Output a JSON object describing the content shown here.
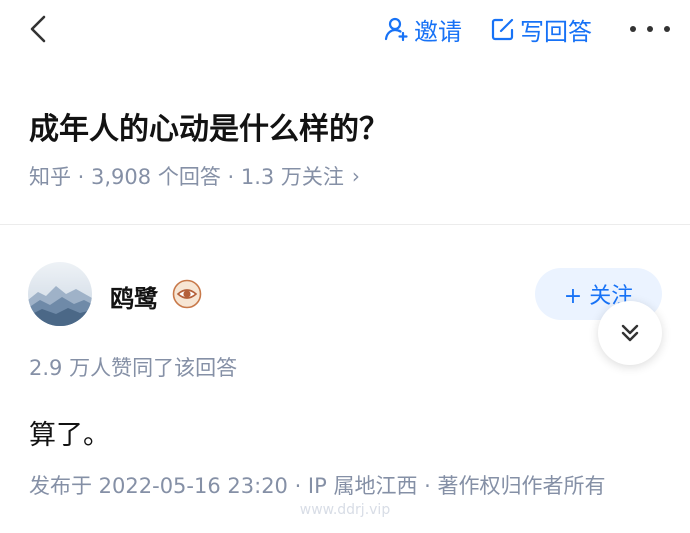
{
  "header": {
    "invite_label": "邀请",
    "write_label": "写回答",
    "icons": {
      "back": "chevron-left-icon",
      "invite": "add-person-icon",
      "write": "edit-icon",
      "more": "more-horizontal-icon"
    }
  },
  "question": {
    "title": "成年人的心动是什么样的？",
    "meta": "知乎 · 3,908 个回答 · 1.3 万关注",
    "meta_chevron": "›"
  },
  "answer": {
    "author_name": "鸥鹭",
    "follow_label": "+ 关注",
    "likes_text": "2.9 万人赞同了该回答",
    "content": "算了。",
    "publish_info": "发布于 2022-05-16 23:20 · IP 属地江西 · 著作权归作者所有"
  },
  "watermark": "www.ddrj.vip",
  "colors": {
    "accent": "#1772f6",
    "muted": "#8590a6",
    "follow_bg": "#ebf3ff",
    "text": "#121212"
  }
}
